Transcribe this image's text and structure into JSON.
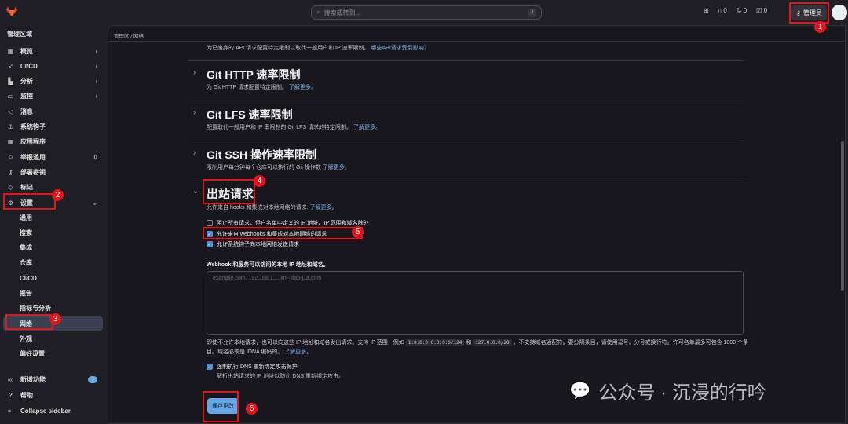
{
  "topbar": {
    "search_placeholder": "搜索或转到...",
    "search_key": "/",
    "issues": "0",
    "mrs": "0",
    "todos": "0",
    "admin_label": "管理员"
  },
  "sidebar": {
    "heading": "管理区域",
    "items": [
      {
        "label": "概览",
        "icon": "grid-icon",
        "tail": "›"
      },
      {
        "label": "CI/CD",
        "icon": "rocket-icon",
        "tail": "›"
      },
      {
        "label": "分析",
        "icon": "chart-icon",
        "tail": "›"
      },
      {
        "label": "监控",
        "icon": "monitor-icon",
        "tail": "›"
      },
      {
        "label": "消息",
        "icon": "megaphone-icon",
        "tail": ""
      },
      {
        "label": "系统钩子",
        "icon": "anchor-icon",
        "tail": ""
      },
      {
        "label": "应用程序",
        "icon": "apps-icon",
        "tail": ""
      },
      {
        "label": "举报滥用",
        "icon": "abuse-icon",
        "tail": "0"
      },
      {
        "label": "部署密钥",
        "icon": "key-icon",
        "tail": ""
      },
      {
        "label": "标记",
        "icon": "label-icon",
        "tail": ""
      },
      {
        "label": "设置",
        "icon": "gear-icon",
        "tail": "⌄"
      }
    ],
    "settings_sub": [
      "通用",
      "搜索",
      "集成",
      "仓库",
      "CI/CD",
      "报告",
      "指标与分析",
      "网络",
      "外观",
      "偏好设置"
    ],
    "whats_new": "新增功能",
    "whats_new_count": "5",
    "help": "帮助",
    "collapse": "Collapse sidebar"
  },
  "breadcrumb": {
    "root": "管理区",
    "sep": "/",
    "current": "网络"
  },
  "main": {
    "top_desc": "为已废弃的 API 请求配置特定限制以取代一般用户和 IP 速率限制。",
    "top_link": "哪些API请求受到影响？",
    "sections": [
      {
        "title": "Git HTTP 速率限制",
        "desc": "为 Git HTTP 请求配置特定限制。",
        "link": "了解更多。"
      },
      {
        "title": "Git LFS 速率限制",
        "desc": "配置取代一般用户和 IP 率限制的 Git LFS 请求的特定限制。",
        "link": "了解更多。"
      },
      {
        "title": "Git SSH 操作速率限制",
        "desc": "限制用户每分钟每个仓库可以执行的 Git 操作数",
        "link": "了解更多。"
      }
    ],
    "outbound": {
      "title": "出站请求",
      "desc": "允许来自 hooks 和集成对本地网络的请求.",
      "link": "了解更多。",
      "checkboxes": [
        {
          "label": "阻止所有请求，但白名单中定义的 IP 地址、IP 范围和域名除外",
          "checked": false
        },
        {
          "label": "允许来自 webhooks 和集成对本地网络的请求",
          "checked": true
        },
        {
          "label": "允许系统钩子向本地网络发送请求",
          "checked": true
        }
      ],
      "textarea_label": "Webhook 和服务可以访问的本地 IP 地址和域名。",
      "textarea_placeholder": "example.com, 192.168.1.1, xn--itlab-j1a.com",
      "help_1": "即使不允许本地请求，也可以向这些 IP 地址和域名发出请求。支持 IP 范围，例如",
      "code_1": "1:0:0:0:0:0:0:0/124",
      "help_and": "和",
      "code_2": "127.0.0.0/28",
      "help_2": "。不支持域名通配符。要分隔条目，请使用逗号、分号或换行符。许可名单最多可包含 1000 个条目。域名必须是 IDNA 编码的。",
      "help_link": "了解更多。",
      "dns_label": "强制执行 DNS 重新绑定攻击保护",
      "dns_checked": true,
      "dns_help": "解析出站请求的 IP 地址以防止 DNS 重新绑定攻击。",
      "save": "保存更改"
    }
  },
  "annotations": [
    "1",
    "2",
    "3",
    "4",
    "5",
    "6"
  ],
  "watermark": "公众号 · 沉浸的行吟"
}
